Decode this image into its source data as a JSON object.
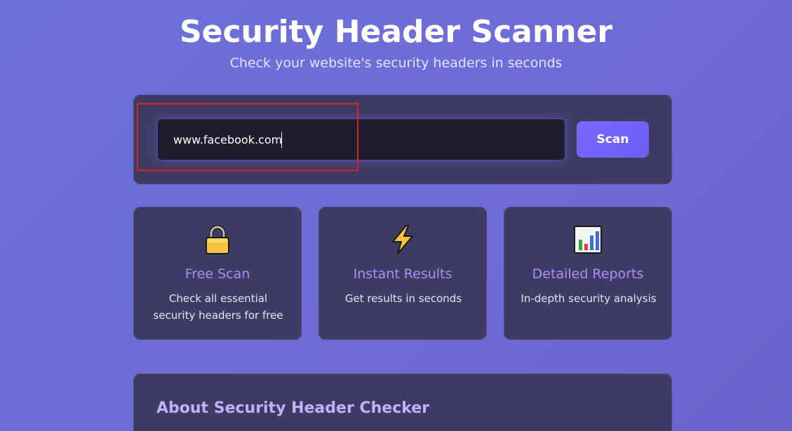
{
  "header": {
    "title": "Security Header Scanner",
    "subtitle": "Check your website's security headers in seconds"
  },
  "scan": {
    "input_value": "www.facebook.com",
    "button_label": "Scan"
  },
  "features": [
    {
      "icon": "lock-icon",
      "title": "Free Scan",
      "description": "Check all essential security headers for free"
    },
    {
      "icon": "lightning-icon",
      "title": "Instant Results",
      "description": "Get results in seconds"
    },
    {
      "icon": "bar-chart-icon",
      "title": "Detailed Reports",
      "description": "In-depth security analysis"
    }
  ],
  "about": {
    "title": "About Security Header Checker"
  },
  "colors": {
    "background": "#6b6fd8",
    "panel": "#3e3c63",
    "accent": "#7a68ff",
    "feature_title": "#ae8cff",
    "highlight": "#e02020"
  }
}
